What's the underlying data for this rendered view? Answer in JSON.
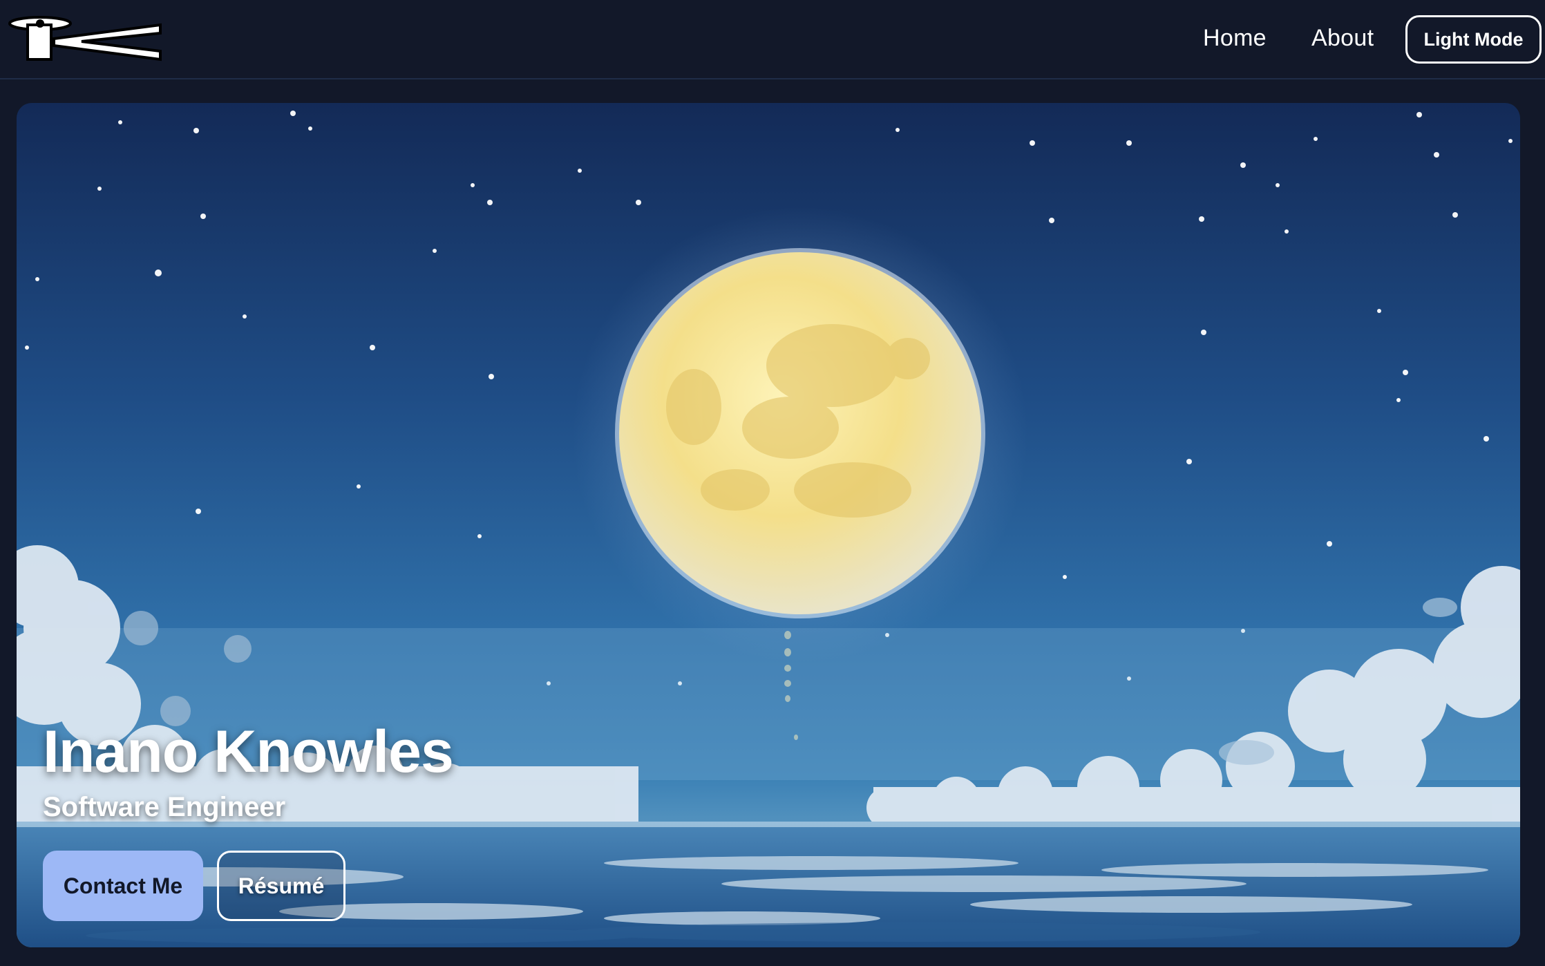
{
  "nav": {
    "links": [
      {
        "label": "Home"
      },
      {
        "label": "About"
      }
    ],
    "mode_toggle_label": "Light Mode"
  },
  "hero": {
    "name": "Inano Knowles",
    "role": "Software Engineer",
    "contact_label": "Contact Me",
    "resume_label": "Résumé",
    "background": "night-sky-moon-ocean-illustration"
  },
  "colors": {
    "page_background": "#121829",
    "accent": "#9db8f6",
    "text": "#ffffff"
  }
}
